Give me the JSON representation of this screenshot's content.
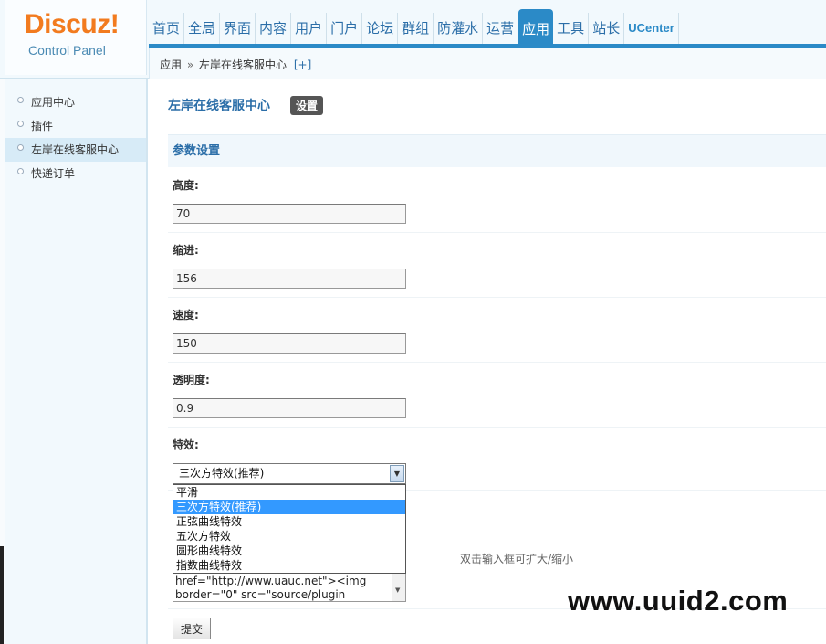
{
  "logo": {
    "brand": "Discuz",
    "bang": "!",
    "subtitle": "Control Panel"
  },
  "topnav": {
    "items": [
      "首页",
      "全局",
      "界面",
      "内容",
      "用户",
      "门户",
      "论坛",
      "群组",
      "防灌水",
      "运营",
      "应用",
      "工具",
      "站长",
      "UCenter"
    ],
    "active": "应用"
  },
  "breadcrumb": {
    "root": "应用",
    "separator": "»",
    "current": "左岸在线客服中心",
    "expand": "[+]"
  },
  "sidebar": {
    "items": [
      "应用中心",
      "插件",
      "左岸在线客服中心",
      "快递订单"
    ],
    "active": "左岸在线客服中心"
  },
  "main": {
    "title": "左岸在线客服中心",
    "settings_button": "设置",
    "section_title": "参数设置",
    "fields": {
      "height": {
        "label": "高度:",
        "value": "70"
      },
      "indent": {
        "label": "缩进:",
        "value": "156"
      },
      "speed": {
        "label": "速度:",
        "value": "150"
      },
      "opacity": {
        "label": "透明度:",
        "value": "0.9"
      },
      "effect": {
        "label": "特效:",
        "selected": "三次方特效(推荐)",
        "options": [
          "平滑",
          "三次方特效(推荐)",
          "正弦曲线特效",
          "五次方特效",
          "圆形曲线特效",
          "指数曲线特效"
        ]
      }
    },
    "textarea": {
      "line1": "href=\"http://www.uauc.net\"><img",
      "line2": "border=\"0\" src=\"source/plugin"
    },
    "textarea_hint": "双击输入框可扩大/缩小",
    "submit_label": "提交"
  },
  "watermark": "www.uuid2.com",
  "colors": {
    "accent": "#2b8ac7",
    "logo_orange": "#f27b1f",
    "selection": "#3399ff"
  }
}
